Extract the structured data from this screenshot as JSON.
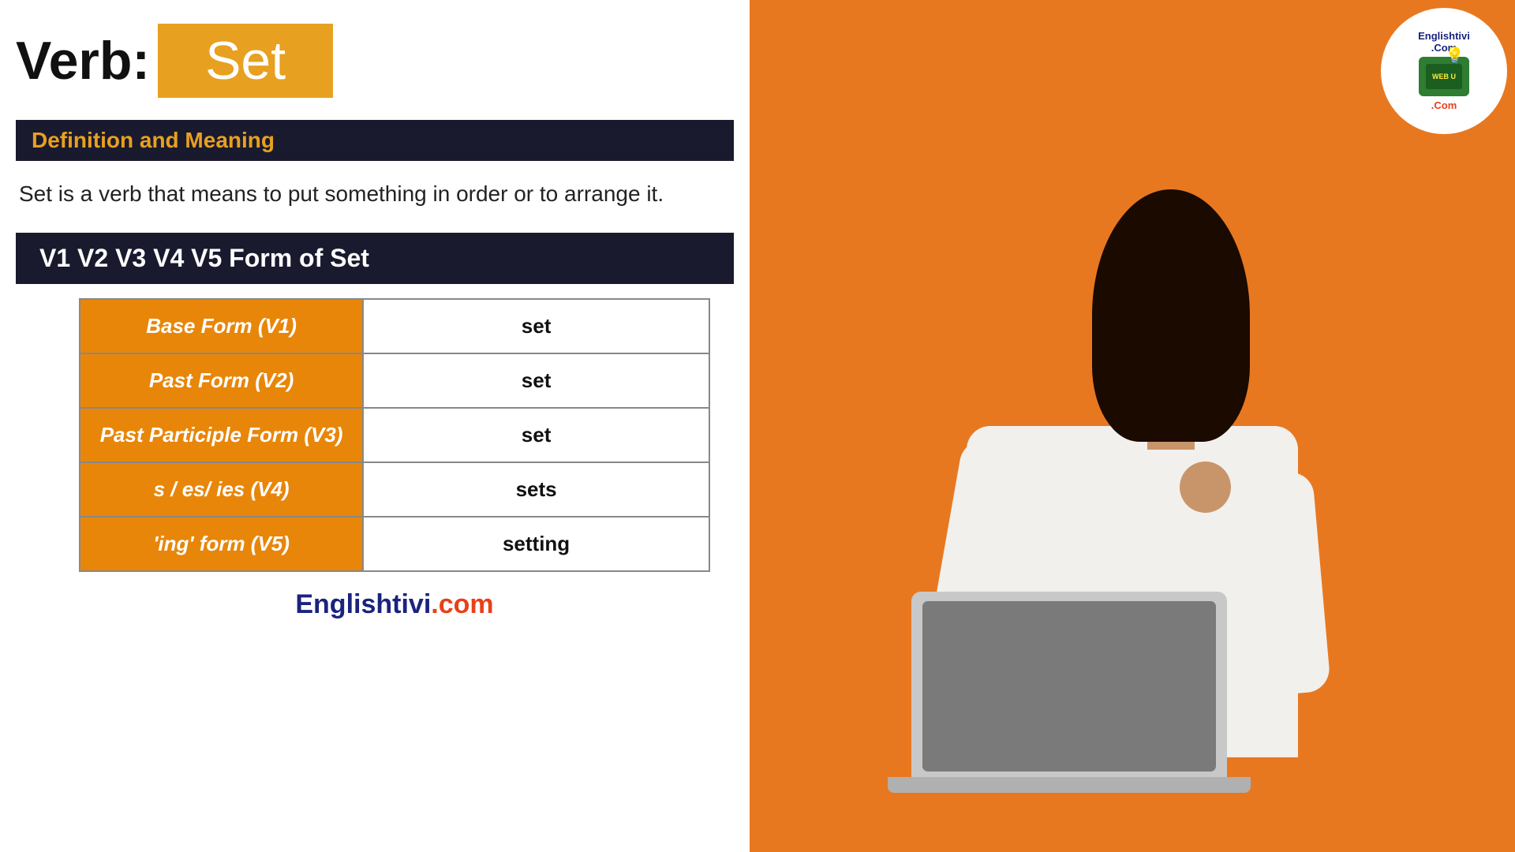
{
  "page": {
    "background_left": "#ffffff",
    "background_right": "#E87820"
  },
  "header": {
    "verb_label": "Verb:",
    "verb_word": "Set",
    "verb_box_color": "#E8A020"
  },
  "definition_section": {
    "heading": "Definition and Meaning",
    "heading_bg": "#1a1a2e",
    "heading_color": "#E8A020",
    "body_text": "Set is a verb that means to put something in order or to arrange it."
  },
  "forms_section": {
    "heading": "V1 V2 V3 V4 V5 Form of Set",
    "heading_bg": "#1a1a2e",
    "heading_color": "#ffffff",
    "table": {
      "rows": [
        {
          "label": "Base Form (V1)",
          "value": "set"
        },
        {
          "label": "Past Form (V2)",
          "value": "set"
        },
        {
          "label": "Past Participle Form (V3)",
          "value": "set"
        },
        {
          "label": "s / es/ ies (V4)",
          "value": "sets"
        },
        {
          "label": "'ing' form (V5)",
          "value": "setting"
        }
      ]
    }
  },
  "footer": {
    "brand_blue": "Englishtivi",
    "brand_orange": ".com"
  },
  "logo": {
    "text_top": "Englishtivi.Com",
    "tv_text": "WEB U",
    "text_bottom": ".Com"
  }
}
